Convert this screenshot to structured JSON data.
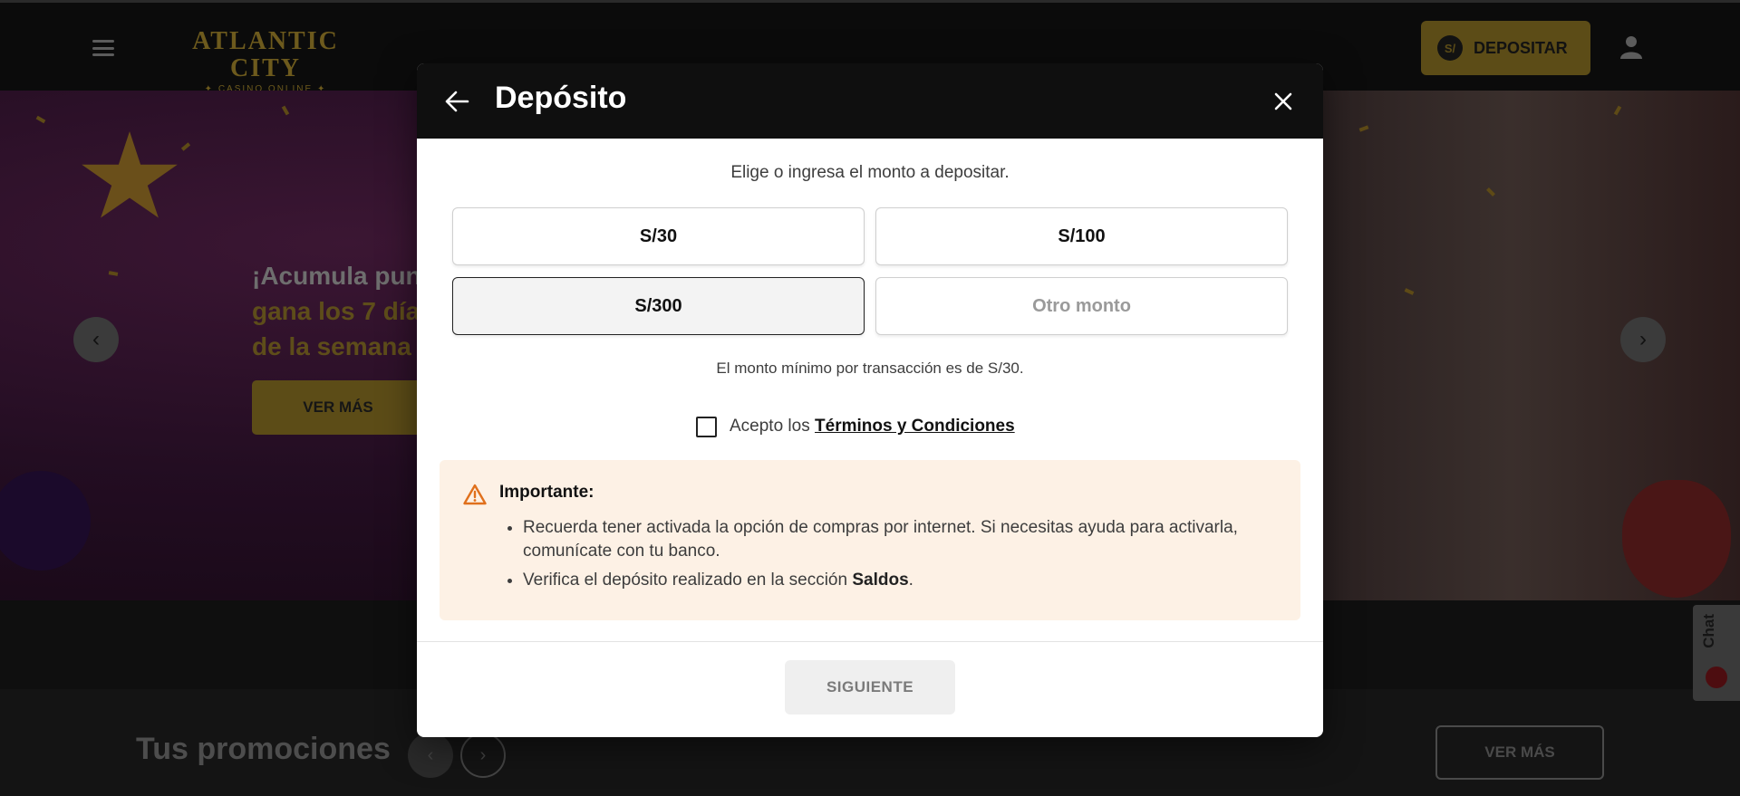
{
  "header": {
    "logo_main": "ATLANTIC CITY",
    "logo_sub": "✦ CASINO ONLINE ✦",
    "deposit_button": "DEPOSITAR",
    "currency_symbol": "S/"
  },
  "hero": {
    "line1": "¡Acumula pun",
    "line2": "gana los 7 día",
    "line3": "de la semana",
    "cta": "VER MÁS",
    "prev_arrow": "‹",
    "next_arrow": "›"
  },
  "promotions": {
    "title": "Tus promociones",
    "cta": "VER MÁS",
    "prev": "‹",
    "next": "›"
  },
  "chat": {
    "label": "Chat"
  },
  "modal": {
    "title": "Depósito",
    "instruction": "Elige o ingresa el monto a depositar.",
    "amounts": [
      {
        "label": "S/30",
        "selected": false
      },
      {
        "label": "S/100",
        "selected": false
      },
      {
        "label": "S/300",
        "selected": true
      }
    ],
    "other_amount": "Otro monto",
    "minimum_text": "El monto mínimo por transacción es de S/30.",
    "terms_prefix": "Acepto los",
    "terms_link": "Términos y Condiciones",
    "terms_checked": false,
    "notice": {
      "title": "Importante:",
      "item1": "Recuerda tener activada la opción de compras por internet. Si necesitas ayuda para activarla, comunícate con tu banco.",
      "item2_prefix": "Verifica el depósito realizado en la sección",
      "item2_bold": "Saldos",
      "item2_suffix": "."
    },
    "next_button": "SIGUIENTE"
  },
  "colors": {
    "gold": "#5c4c17",
    "modal_header": "#0f0f0f",
    "notice_bg": "#fdf1e5",
    "warning_orange": "#e0701c"
  }
}
